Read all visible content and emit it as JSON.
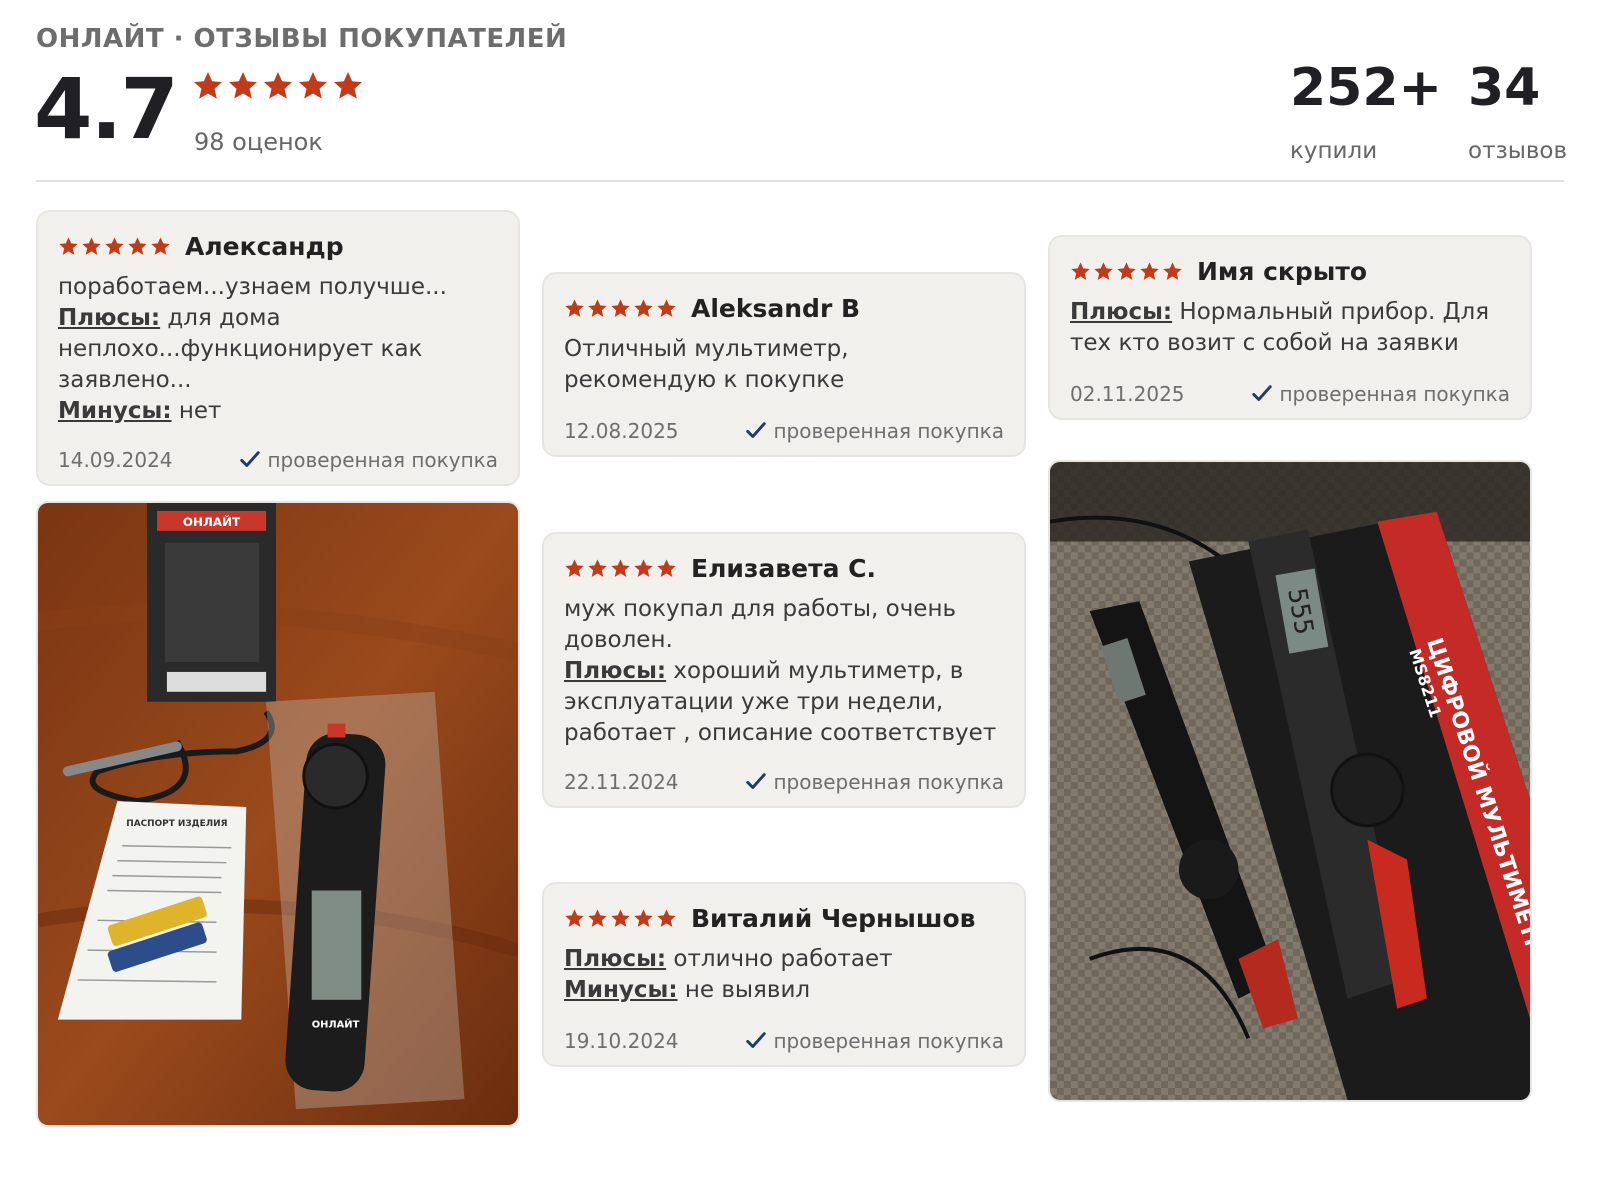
{
  "header": {
    "eyebrow": "ОНЛАЙТ · ОТЗЫВЫ ПОКУПАТЕЛЕЙ",
    "rating": "4.7",
    "rating_count": "98 оценок",
    "stars": 5
  },
  "stats": [
    {
      "value": "252+",
      "label": "купили"
    },
    {
      "value": "34",
      "label": "отзывов"
    }
  ],
  "colors": {
    "star": "#c23a18",
    "check": "#1f3a6e",
    "card_bg": "#f1f0ed"
  },
  "verified_label": "проверенная покупка",
  "icons": {
    "star": "star-icon",
    "check": "check-icon"
  },
  "reviews": [
    {
      "author": "Александр",
      "stars": 5,
      "text": "поработаем...узнаем получше...",
      "pros_label": "Плюсы:",
      "pros": "для дома неплохо...функционирует как заявлено...",
      "cons_label": "Минусы:",
      "cons": "нет",
      "date": "14.09.2024"
    },
    {
      "author": "Aleksandr B",
      "stars": 5,
      "text": "Отличный мультиметр, рекомендую к покупке",
      "date": "12.08.2025"
    },
    {
      "author": "Елизавета С.",
      "stars": 5,
      "text": "муж покупал для работы, очень доволен.",
      "pros_label": "Плюсы:",
      "pros": "хороший мультиметр, в эксплуатации уже три недели, работает , описание соответствует",
      "date": "22.11.2024"
    },
    {
      "author": "Виталий Чернышов",
      "stars": 5,
      "pros_label": "Плюсы:",
      "pros": "отлично работает",
      "cons_label": "Минусы:",
      "cons": "не выявил",
      "date": "19.10.2024"
    },
    {
      "author": "Имя скрыто",
      "stars": 5,
      "pros_label": "Плюсы:",
      "pros": "Нормальный прибор. Для тех кто возит с собой на заявки",
      "date": "02.11.2025"
    }
  ],
  "photos": {
    "left": {
      "box_brand": "ОНЛАЙТ",
      "device_brand": "ОНЛАЙТ",
      "manual_title": "ПАСПОРТ ИЗДЕЛИЯ"
    },
    "right": {
      "box_model": "MS8211",
      "box_title": "ЦИФРОВОЙ МУЛЬТИМЕТР",
      "display_value": "555"
    }
  }
}
